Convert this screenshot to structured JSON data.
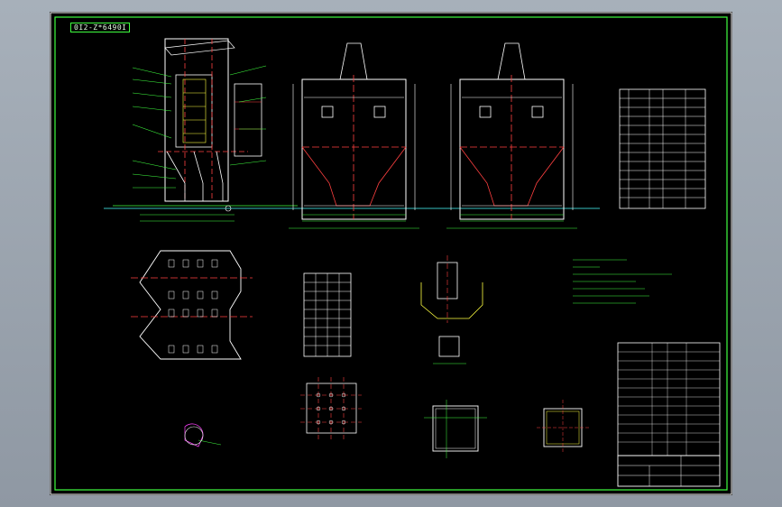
{
  "drawing": {
    "tag": "0I2-Z*6490I"
  }
}
